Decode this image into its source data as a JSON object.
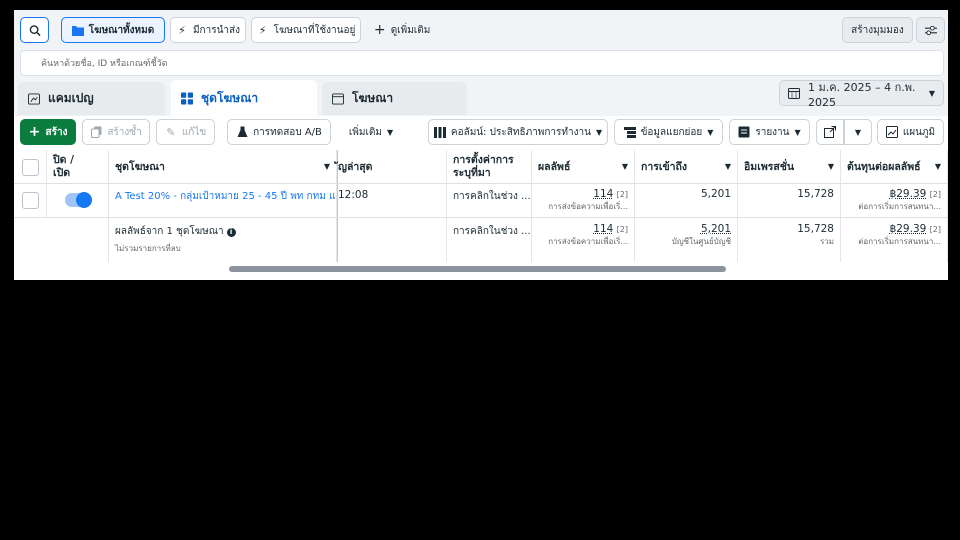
{
  "top_filters": {
    "all_ads": "โฆษณาทั้งหมด",
    "has_delivery": "มีการนำส่ง",
    "active_ads": "โฆษณาที่ใช้งานอยู่",
    "see_more": "ดูเพิ่มเติม",
    "create_view": "สร้างมุมมอง"
  },
  "search": {
    "placeholder": "ค้นหาด้วยชื่อ, ID หรือเกณฑ์ชี้วัด"
  },
  "tabs": [
    {
      "label": "แคมเปญ"
    },
    {
      "label": "ชุดโฆษณา"
    },
    {
      "label": "โฆษณา"
    }
  ],
  "date_range": "1 ม.ค. 2025 – 4 ก.พ. 2025",
  "toolbar": {
    "create": "สร้าง",
    "duplicate": "สร้างซ้ำ",
    "edit": "แก้ไข",
    "ab_test": "การทดสอบ A/B",
    "more": "เพิ่มเติม",
    "columns": "คอลัมน์: ประสิทธิภาพการทำงาน",
    "breakdown": "ข้อมูลแยกย่อย",
    "reports": "รายงาน",
    "charts": "แผนภูมิ"
  },
  "table": {
    "headers": {
      "onoff": "ปิด / เปิด",
      "adset": "ชุดโฆษณา",
      "latest": "ัญล่าสุด",
      "bid_strategy": "การตั้งค่าการระบุที่มา",
      "results": "ผลลัพธ์",
      "reach": "การเข้าถึง",
      "impressions": "อิมเพรสชั่น",
      "cost_per_result": "ต้นทุนต่อผลลัพธ์"
    },
    "rows": [
      {
        "name": "A Test 20% - กลุ่มเป้าหมาย 25 - 45 ปี พท กทม แ...",
        "latest": "12:08",
        "bid": "การคลิกในช่วง ...",
        "results": "114",
        "results_note": "[2]",
        "results_sub": "การส่งข้อความเพื่อเริ่...",
        "reach": "5,201",
        "impressions": "15,728",
        "cost": "฿29.39",
        "cost_note": "[2]",
        "cost_sub": "ต่อการเริ่มการสนทนา..."
      }
    ],
    "summary": {
      "name": "ผลลัพธ์จาก 1 ชุดโฆษณา",
      "sub": "ไม่รวมรายการที่ลบ",
      "bid": "การคลิกในช่วง ...",
      "results": "114",
      "results_note": "[2]",
      "results_sub": "การส่งข้อความเพื่อเริ่...",
      "reach": "5,201",
      "reach_sub": "บัญชีในศูนย์บัญชี",
      "impressions": "15,728",
      "impressions_sub": "รวม",
      "cost": "฿29.39",
      "cost_note": "[2]",
      "cost_sub": "ต่อการเริ่มการสนทนา..."
    }
  },
  "colors": {
    "accent": "#1877f2",
    "create_green": "#0a7d3e",
    "tab_active_text": "#0a5fc2"
  }
}
